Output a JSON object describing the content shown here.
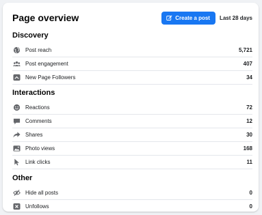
{
  "header": {
    "title": "Page overview",
    "create_post_label": "Create a post",
    "date_range": "Last 28 days"
  },
  "colors": {
    "accent": "#1877f2",
    "icon": "#65676b"
  },
  "sections": [
    {
      "title": "Discovery",
      "rows": [
        {
          "icon": "globe-icon",
          "label": "Post reach",
          "value": "5,721"
        },
        {
          "icon": "people-icon",
          "label": "Post engagement",
          "value": "407"
        },
        {
          "icon": "follower-icon",
          "label": "New Page Followers",
          "value": "34"
        }
      ]
    },
    {
      "title": "Interactions",
      "rows": [
        {
          "icon": "reactions-icon",
          "label": "Reactions",
          "value": "72"
        },
        {
          "icon": "comment-icon",
          "label": "Comments",
          "value": "12"
        },
        {
          "icon": "share-icon",
          "label": "Shares",
          "value": "30"
        },
        {
          "icon": "photo-icon",
          "label": "Photo views",
          "value": "168"
        },
        {
          "icon": "cursor-icon",
          "label": "Link clicks",
          "value": "11"
        }
      ]
    },
    {
      "title": "Other",
      "rows": [
        {
          "icon": "hide-icon",
          "label": "Hide all posts",
          "value": "0"
        },
        {
          "icon": "unfollow-icon",
          "label": "Unfollows",
          "value": "0"
        }
      ]
    }
  ]
}
